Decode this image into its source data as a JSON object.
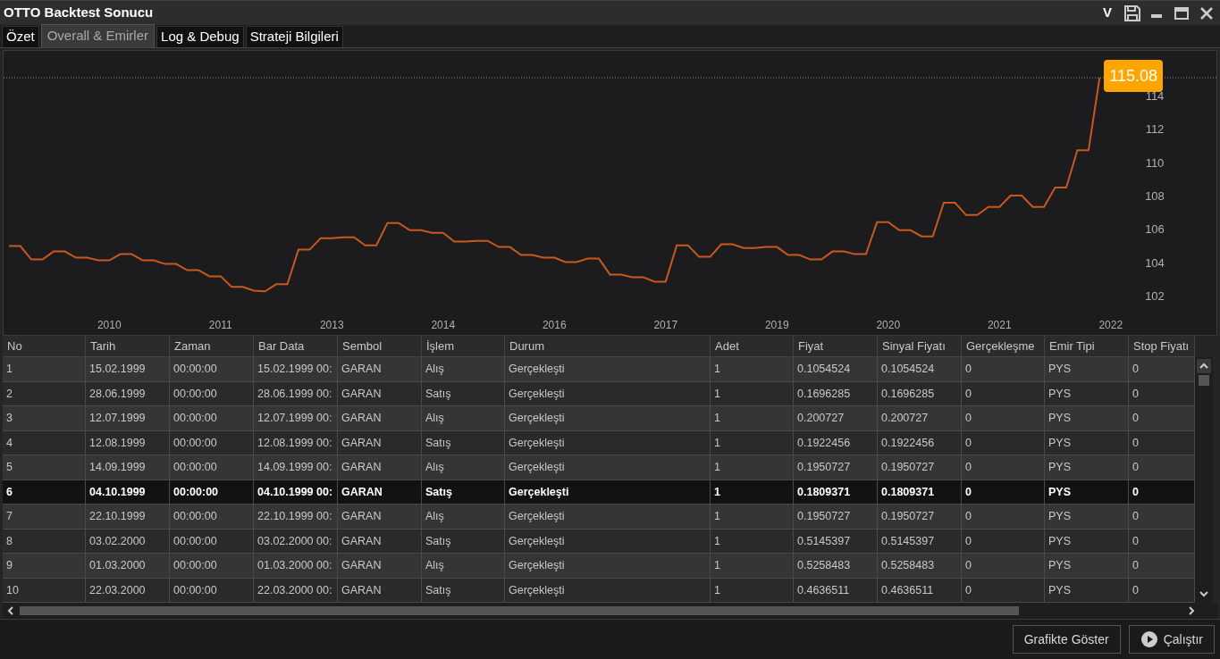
{
  "window": {
    "title": "OTTO Backtest Sonucu",
    "controls_letter": "V"
  },
  "tabs": [
    {
      "label": "Özet",
      "selected": false
    },
    {
      "label": "Overall & Emirler",
      "selected": true
    },
    {
      "label": "Log & Debug",
      "selected": false
    },
    {
      "label": "Strateji Bilgileri",
      "selected": false
    }
  ],
  "chart": {
    "last_value_badge": "115.08",
    "chart_data": {
      "type": "line",
      "ylim": [
        99.63,
        116.69
      ],
      "ref_lines": [
        {
          "axis": "y",
          "value": 115.08
        }
      ],
      "categories": [
        null,
        null,
        null,
        null,
        null,
        null,
        null,
        null,
        null,
        "2010",
        null,
        null,
        null,
        null,
        null,
        null,
        null,
        null,
        null,
        "2011",
        null,
        null,
        null,
        null,
        null,
        null,
        null,
        null,
        null,
        "2013",
        null,
        null,
        null,
        null,
        null,
        null,
        null,
        null,
        null,
        "2014",
        null,
        null,
        null,
        null,
        null,
        null,
        null,
        null,
        null,
        "2016",
        null,
        null,
        null,
        null,
        null,
        null,
        null,
        null,
        null,
        "2017",
        null,
        null,
        null,
        null,
        null,
        null,
        null,
        null,
        null,
        "2019",
        null,
        null,
        null,
        null,
        null,
        null,
        null,
        null,
        null,
        "2020",
        null,
        null,
        null,
        null,
        null,
        null,
        null,
        null,
        null,
        "2021",
        null,
        null,
        null,
        null,
        null,
        null,
        null,
        null,
        null,
        "2022"
      ],
      "yticks": [
        102,
        104,
        106,
        108,
        110,
        112,
        114
      ],
      "series": [
        {
          "color": "#c8581e",
          "values": [
            104.96,
            104.96,
            104.16,
            104.16,
            104.64,
            104.64,
            104.27,
            104.27,
            104.11,
            104.11,
            104.48,
            104.48,
            104.11,
            104.11,
            103.89,
            103.89,
            103.52,
            103.52,
            103.15,
            103.15,
            102.51,
            102.51,
            102.29,
            102.24,
            102.67,
            102.67,
            104.75,
            104.75,
            105.44,
            105.44,
            105.49,
            105.49,
            105.01,
            105.01,
            106.35,
            106.35,
            105.92,
            105.92,
            105.76,
            105.76,
            105.23,
            105.23,
            105.28,
            105.28,
            104.91,
            104.91,
            104.43,
            104.43,
            104.27,
            104.27,
            104.0,
            104.0,
            104.21,
            104.21,
            103.25,
            103.25,
            103.09,
            103.09,
            102.83,
            102.83,
            105.01,
            105.01,
            104.32,
            104.32,
            105.07,
            105.07,
            104.85,
            104.85,
            104.91,
            104.91,
            104.43,
            104.43,
            104.16,
            104.16,
            104.64,
            104.64,
            104.48,
            104.48,
            106.4,
            106.4,
            105.92,
            105.92,
            105.55,
            105.55,
            107.57,
            107.57,
            106.83,
            106.83,
            107.31,
            107.31,
            108.0,
            108.0,
            107.31,
            107.31,
            108.48,
            108.48,
            110.72,
            110.72,
            115.08,
            null
          ]
        }
      ]
    }
  },
  "table": {
    "columns": [
      "No",
      "Tarih",
      "Zaman",
      "Bar Data",
      "Sembol",
      "İşlem",
      "Durum",
      "Adet",
      "Fiyat",
      "Sinyal Fiyatı",
      "Gerçekleşme",
      "Emir Tipi",
      "Stop Fiyatı"
    ],
    "rows": [
      {
        "selected": false,
        "cells": [
          "1",
          "15.02.1999",
          "00:00:00",
          "15.02.1999 00:",
          "GARAN",
          "Alış",
          "Gerçekleşti",
          "1",
          "0.1054524",
          "0.1054524",
          "0",
          "PYS",
          "0"
        ]
      },
      {
        "selected": false,
        "cells": [
          "2",
          "28.06.1999",
          "00:00:00",
          "28.06.1999 00:",
          "GARAN",
          "Satış",
          "Gerçekleşti",
          "1",
          "0.1696285",
          "0.1696285",
          "0",
          "PYS",
          "0"
        ]
      },
      {
        "selected": false,
        "cells": [
          "3",
          "12.07.1999",
          "00:00:00",
          "12.07.1999 00:",
          "GARAN",
          "Alış",
          "Gerçekleşti",
          "1",
          "0.200727",
          "0.200727",
          "0",
          "PYS",
          "0"
        ]
      },
      {
        "selected": false,
        "cells": [
          "4",
          "12.08.1999",
          "00:00:00",
          "12.08.1999 00:",
          "GARAN",
          "Satış",
          "Gerçekleşti",
          "1",
          "0.1922456",
          "0.1922456",
          "0",
          "PYS",
          "0"
        ]
      },
      {
        "selected": false,
        "cells": [
          "5",
          "14.09.1999",
          "00:00:00",
          "14.09.1999 00:",
          "GARAN",
          "Alış",
          "Gerçekleşti",
          "1",
          "0.1950727",
          "0.1950727",
          "0",
          "PYS",
          "0"
        ]
      },
      {
        "selected": true,
        "cells": [
          "6",
          "04.10.1999",
          "00:00:00",
          "04.10.1999 00:",
          "GARAN",
          "Satış",
          "Gerçekleşti",
          "1",
          "0.1809371",
          "0.1809371",
          "0",
          "PYS",
          "0"
        ]
      },
      {
        "selected": false,
        "cells": [
          "7",
          "22.10.1999",
          "00:00:00",
          "22.10.1999 00:",
          "GARAN",
          "Alış",
          "Gerçekleşti",
          "1",
          "0.1950727",
          "0.1950727",
          "0",
          "PYS",
          "0"
        ]
      },
      {
        "selected": false,
        "cells": [
          "8",
          "03.02.2000",
          "00:00:00",
          "03.02.2000 00:",
          "GARAN",
          "Satış",
          "Gerçekleşti",
          "1",
          "0.5145397",
          "0.5145397",
          "0",
          "PYS",
          "0"
        ]
      },
      {
        "selected": false,
        "cells": [
          "9",
          "01.03.2000",
          "00:00:00",
          "01.03.2000 00:",
          "GARAN",
          "Alış",
          "Gerçekleşti",
          "1",
          "0.5258483",
          "0.5258483",
          "0",
          "PYS",
          "0"
        ]
      },
      {
        "selected": false,
        "cells": [
          "10",
          "22.03.2000",
          "00:00:00",
          "22.03.2000 00:",
          "GARAN",
          "Satış",
          "Gerçekleşti",
          "1",
          "0.4636511",
          "0.4636511",
          "0",
          "PYS",
          "0"
        ]
      }
    ]
  },
  "buttons": [
    {
      "label": "Grafikte Göster",
      "kind": "plain"
    },
    {
      "label": "Çalıştır",
      "kind": "play"
    }
  ]
}
